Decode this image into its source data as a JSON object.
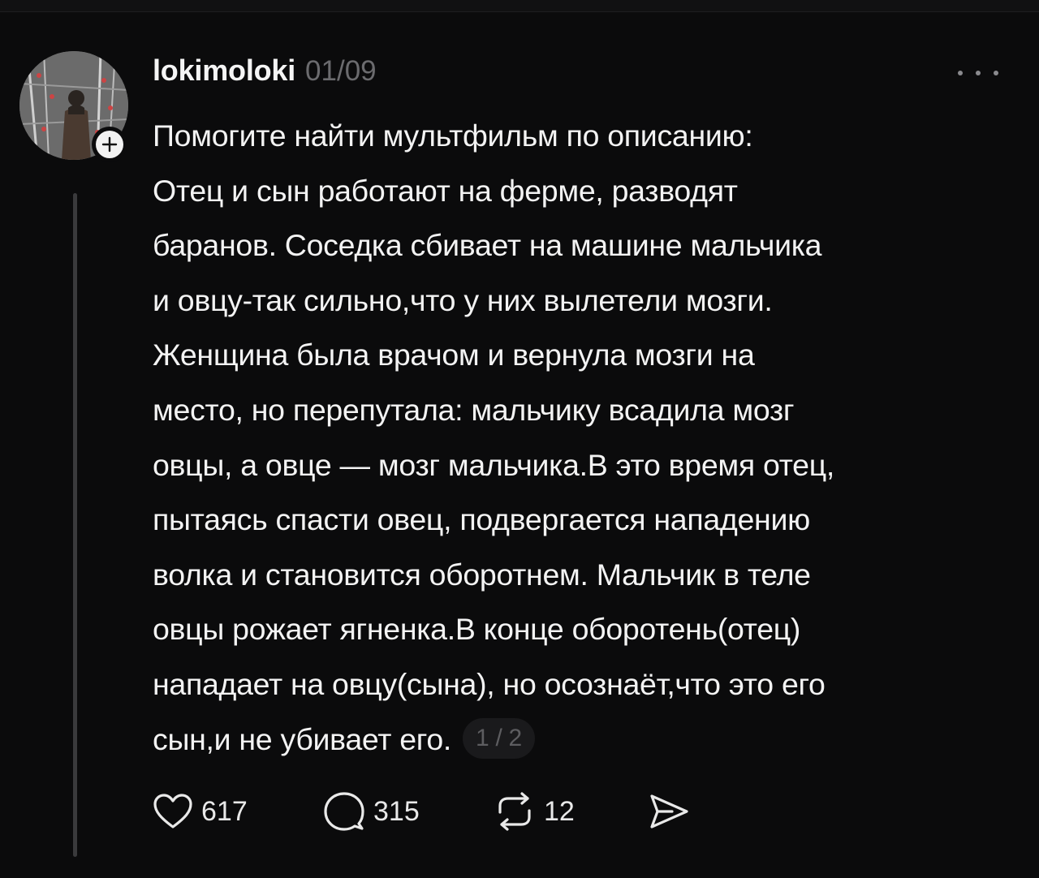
{
  "post": {
    "author": "lokimoloki",
    "date": "01/09",
    "lines": [
      "Помогите найти мультфильм по описанию:",
      "Отец и сын работают на ферме, разводят",
      "баранов. Соседка сбивает на машине мальчика",
      "и овцу-так сильно,что у них вылетели мозги.",
      "Женщина была врачом и вернула мозги на",
      "место, но перепутала: мальчику всадила мозг",
      "овцы, а овце — мозг мальчика.В это время отец,",
      "пытаясь спасти овец, подвергается нападению",
      "волка и становится оборотнем. Мальчик в теле",
      "овцы рожает ягненка.В конце оборотень(отец)",
      "нападает на овцу(сына), но осознаёт,что это его",
      "сын,и не убивает его."
    ],
    "page_indicator": "1 / 2"
  },
  "actions": {
    "likes": "617",
    "replies": "315",
    "reposts": "12"
  },
  "icons": {
    "like": "heart-icon",
    "reply": "speech-bubble-icon",
    "repost": "repost-arrows-icon",
    "share": "send-icon",
    "more": "more-dots-icon",
    "follow": "plus-icon"
  },
  "colors": {
    "background": "#0b0b0c",
    "text": "#f3f3f3",
    "muted": "#6b6b6e",
    "thread_line": "#3a3a3c"
  }
}
